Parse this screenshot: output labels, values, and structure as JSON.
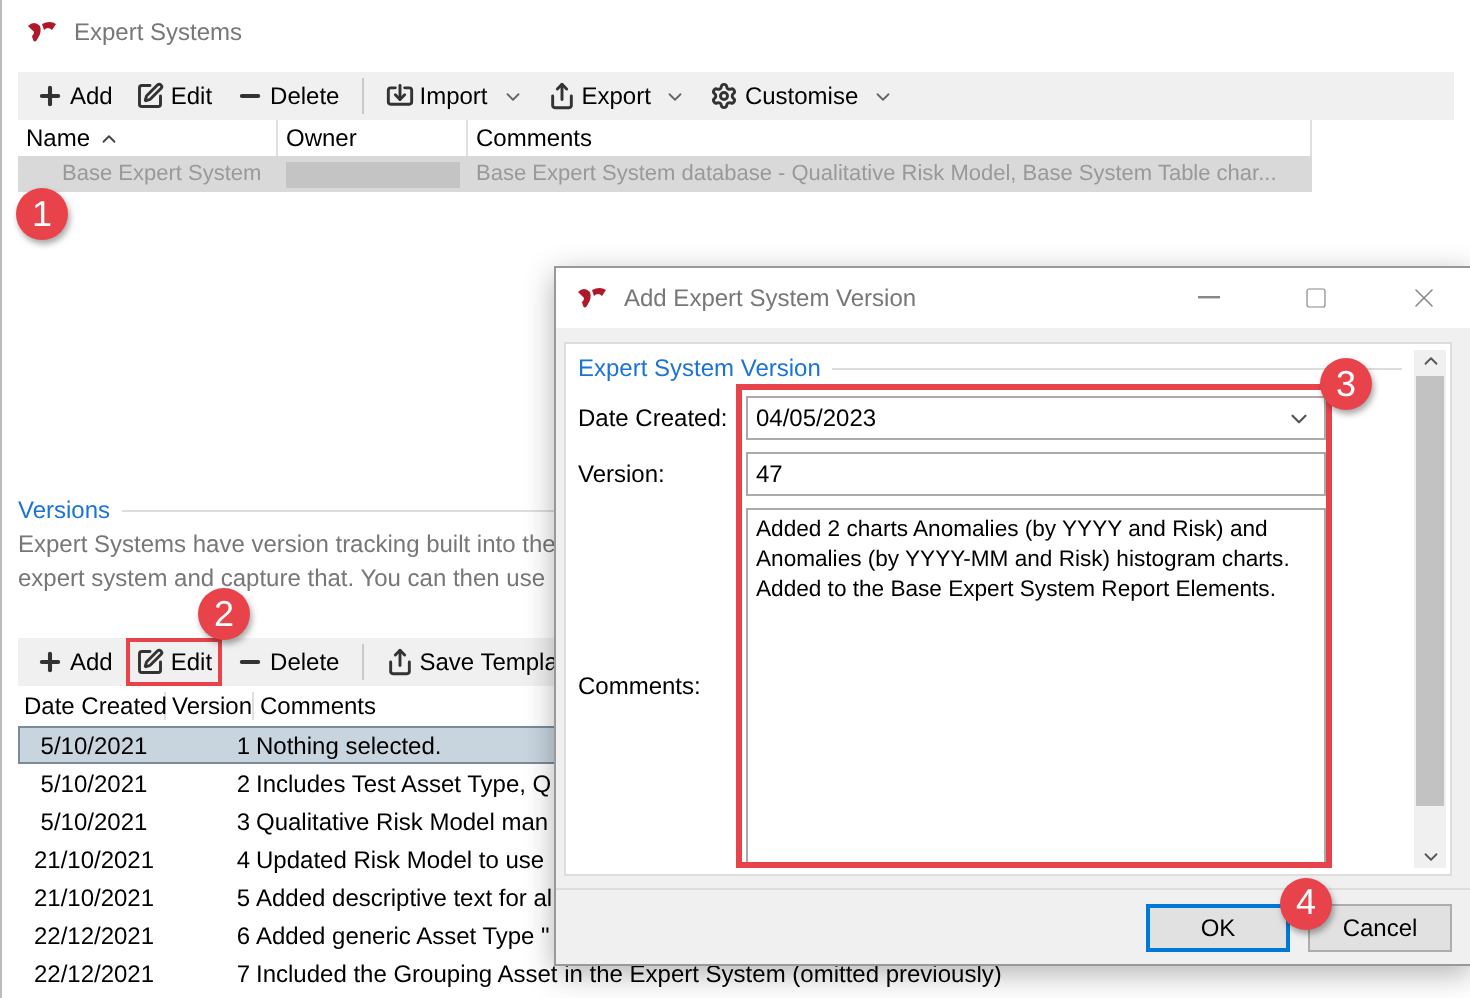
{
  "main_window": {
    "title": "Expert Systems",
    "toolbar": [
      {
        "kind": "button",
        "label": "Add",
        "dropdown": false
      },
      {
        "kind": "button",
        "label": "Edit",
        "dropdown": false
      },
      {
        "kind": "button",
        "label": "Delete",
        "dropdown": false
      },
      {
        "kind": "separator"
      },
      {
        "kind": "button",
        "label": "Import",
        "dropdown": true
      },
      {
        "kind": "button",
        "label": "Export",
        "dropdown": true
      },
      {
        "kind": "button",
        "label": "Customise",
        "dropdown": true
      }
    ],
    "table": {
      "columns": [
        {
          "label": "Name",
          "sorted": true
        },
        {
          "label": "Owner",
          "sorted": false
        },
        {
          "label": "Comments",
          "sorted": false
        }
      ],
      "rows": [
        {
          "name": "Base Expert System",
          "owner_hidden": true,
          "comments": "Base Expert System database - Qualitative Risk Model, Base System Table char...",
          "selected": true
        }
      ]
    },
    "badge": "1"
  },
  "versions": {
    "title": "Versions",
    "description_lines": [
      "Expert Systems have version tracking built into the",
      "expert system and capture that. You can then use"
    ],
    "toolbar": [
      {
        "kind": "button",
        "label": "Add",
        "highlighted": false
      },
      {
        "kind": "button",
        "label": "Edit",
        "highlighted": true,
        "badge": "2"
      },
      {
        "kind": "button",
        "label": "Delete",
        "highlighted": false
      },
      {
        "kind": "separator"
      },
      {
        "kind": "button",
        "label": "Save Templa",
        "highlighted": false
      }
    ],
    "columns": [
      "Date Created",
      "Version",
      "Comments"
    ],
    "rows": [
      {
        "date": "5/10/2021",
        "version": "1",
        "comments": "Nothing selected.",
        "selected": true
      },
      {
        "date": "5/10/2021",
        "version": "2",
        "comments": "Includes Test Asset Type, Q",
        "selected": false
      },
      {
        "date": "5/10/2021",
        "version": "3",
        "comments": "Qualitative Risk Model man",
        "selected": false
      },
      {
        "date": "21/10/2021",
        "version": "4",
        "comments": "Updated Risk Model to use",
        "selected": false
      },
      {
        "date": "21/10/2021",
        "version": "5",
        "comments": "Added descriptive text for al",
        "selected": false
      },
      {
        "date": "22/12/2021",
        "version": "6",
        "comments": "Added generic Asset Type \"",
        "selected": false
      },
      {
        "date": "22/12/2021",
        "version": "7",
        "comments": "Included the Grouping Asset in the Expert System (omitted previously)",
        "selected": false
      }
    ]
  },
  "dialog": {
    "title": "Add Expert System Version",
    "group_title": "Expert System Version",
    "fields": [
      {
        "kind": "dropdown",
        "label": "Date Created:",
        "value": "04/05/2023"
      },
      {
        "kind": "text",
        "label": "Version:",
        "value": "47"
      },
      {
        "kind": "textarea",
        "label": "Comments:",
        "value": "Added 2 charts Anomalies (by YYYY and Risk) and Anomalies (by YYYY-MM and Risk) histogram charts. Added to the Base Expert System Report Elements."
      }
    ],
    "fields_highlighted": true,
    "fields_badge": "3",
    "buttons": [
      {
        "label": "OK",
        "default": true,
        "badge": "4"
      },
      {
        "label": "Cancel",
        "default": false
      }
    ]
  }
}
